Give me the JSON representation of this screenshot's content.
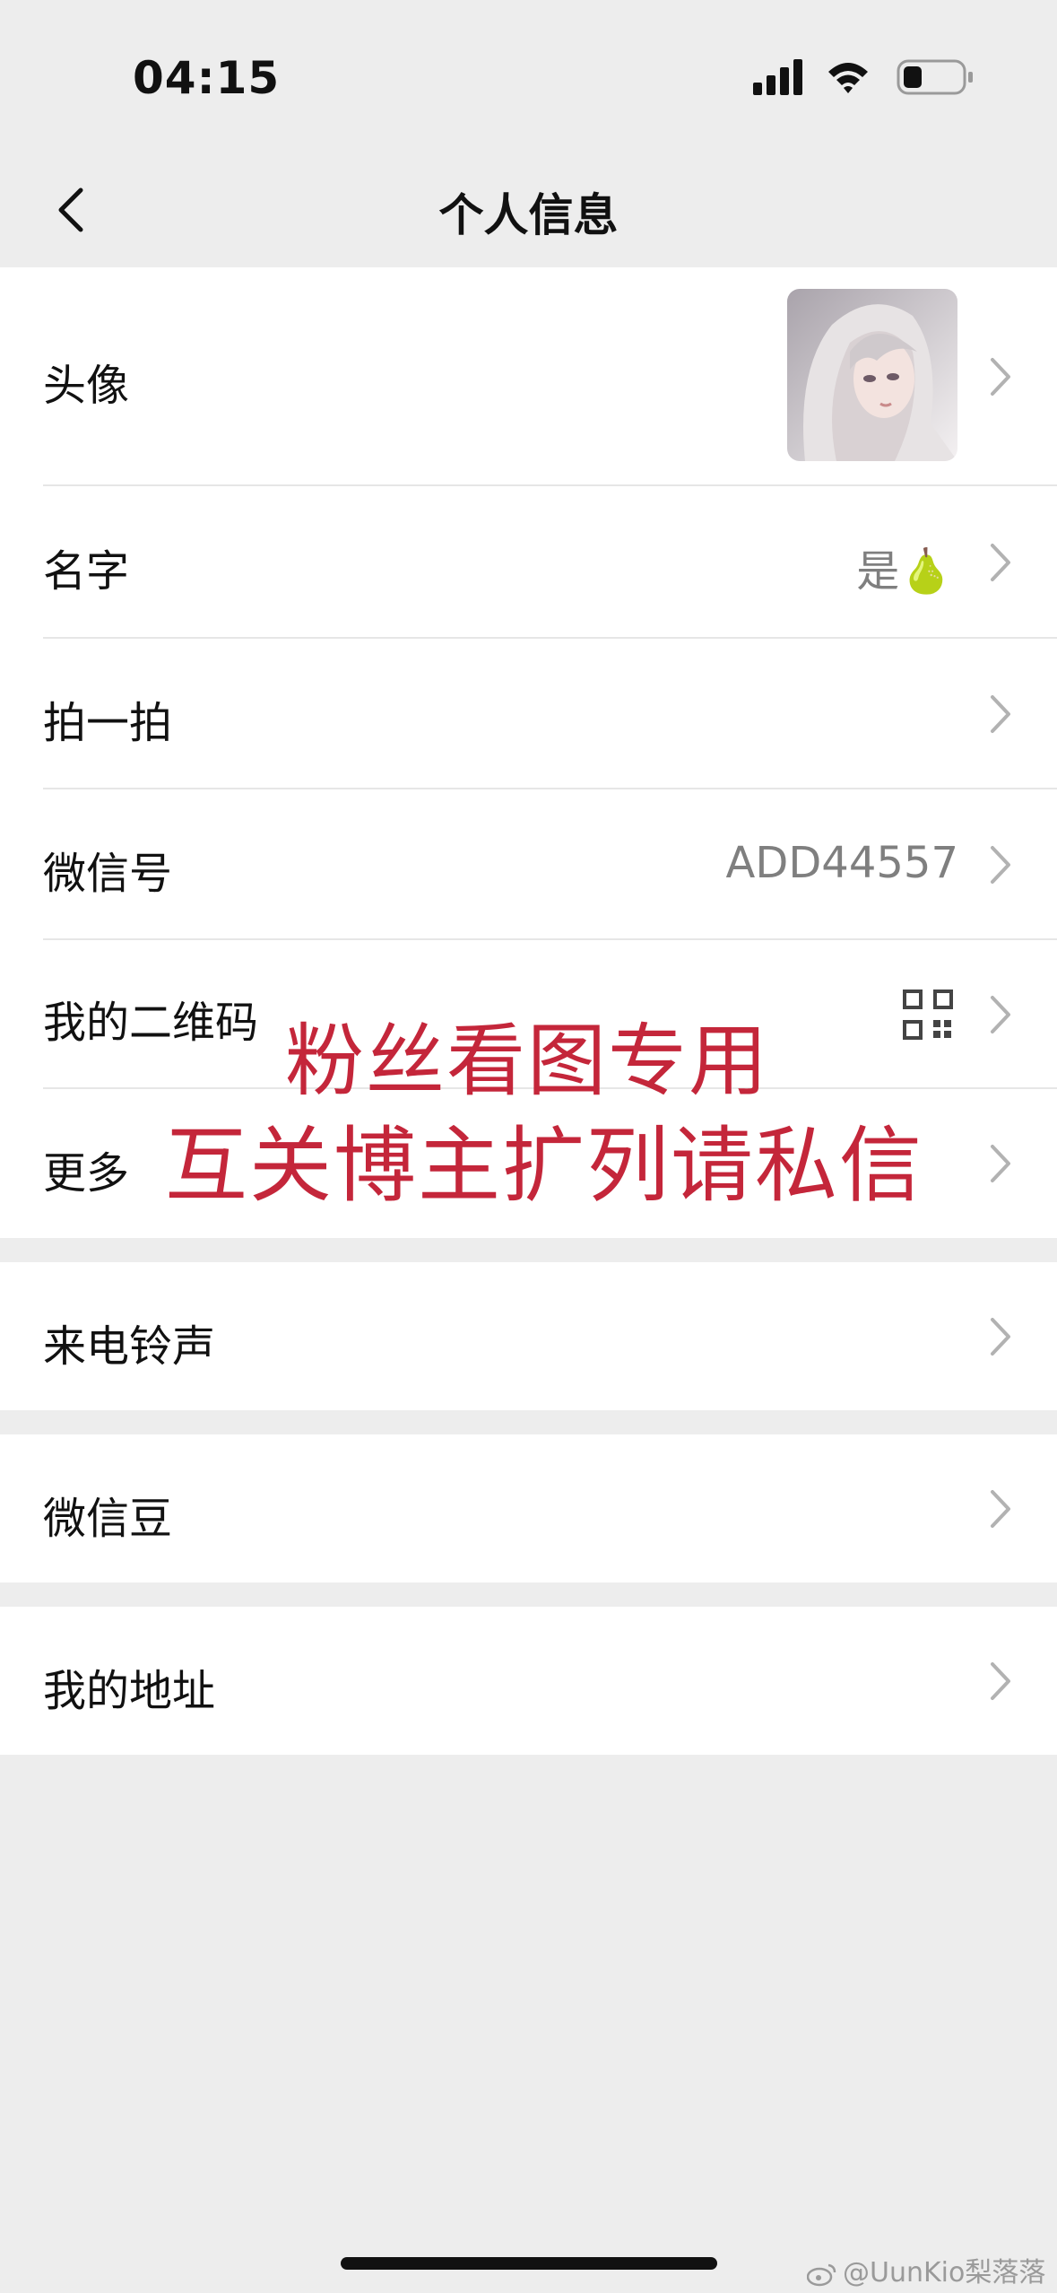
{
  "status": {
    "time": "04:15"
  },
  "nav": {
    "title": "个人信息",
    "back_icon": "chevron-left-icon"
  },
  "profile_rows": {
    "avatar": {
      "label": "头像"
    },
    "name": {
      "label": "名字",
      "value": "是🍐"
    },
    "pat": {
      "label": "拍一拍"
    },
    "wechat_id": {
      "label": "微信号",
      "value": "ADD44557"
    },
    "qr_code": {
      "label": "我的二维码",
      "icon": "qr-code-icon"
    },
    "more": {
      "label": "更多"
    }
  },
  "ringtone": {
    "label": "来电铃声"
  },
  "wechat_beans": {
    "label": "微信豆"
  },
  "address": {
    "label": "我的地址"
  },
  "overlay": {
    "line1": "粉丝看图专用",
    "line2": "互关博主扩列请私信"
  },
  "watermark": {
    "text": "@UunKio梨落落"
  },
  "colors": {
    "background": "#ededed",
    "card": "#ffffff",
    "overlay_text": "#c4263a",
    "value_text": "#7f7f7f"
  }
}
